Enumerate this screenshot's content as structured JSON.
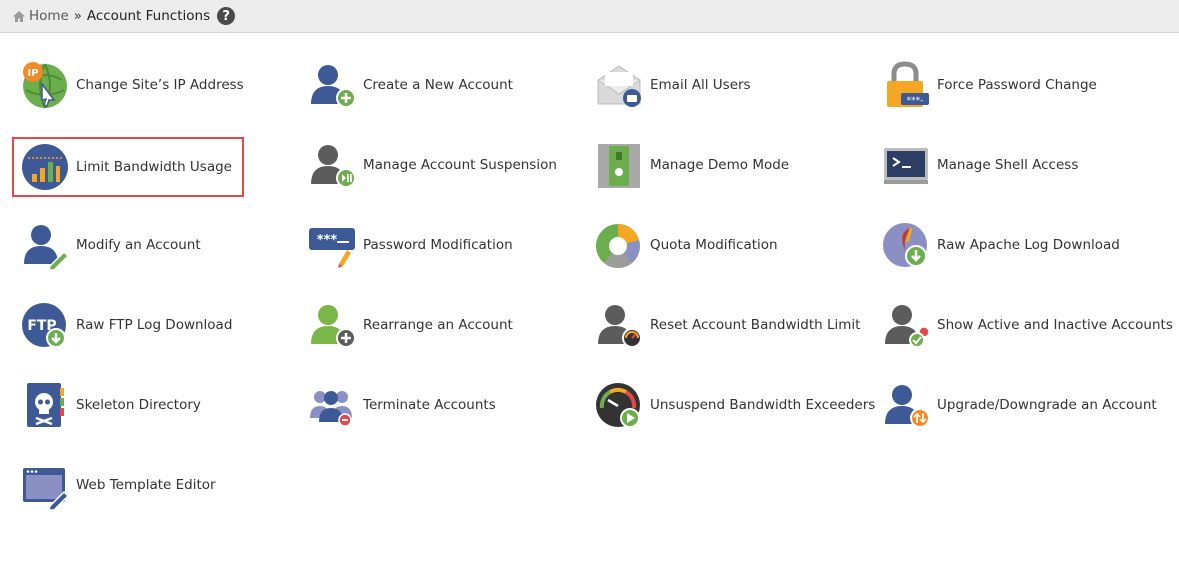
{
  "breadcrumb": {
    "home": "Home",
    "separator": "»",
    "current": "Account Functions",
    "help": "?"
  },
  "items": [
    {
      "label": "Change Site’s IP Address",
      "icon": "ip-address-icon"
    },
    {
      "label": "Create a New Account",
      "icon": "create-account-icon"
    },
    {
      "label": "Email All Users",
      "icon": "email-icon"
    },
    {
      "label": "Force Password Change",
      "icon": "padlock-icon"
    },
    {
      "label": "Limit Bandwidth Usage",
      "icon": "bandwidth-chart-icon",
      "selected": true
    },
    {
      "label": "Manage Account Suspension",
      "icon": "account-suspension-icon"
    },
    {
      "label": "Manage Demo Mode",
      "icon": "demo-mode-icon"
    },
    {
      "label": "Manage Shell Access",
      "icon": "terminal-icon"
    },
    {
      "label": "Modify an Account",
      "icon": "modify-account-icon"
    },
    {
      "label": "Password Modification",
      "icon": "password-icon"
    },
    {
      "label": "Quota Modification",
      "icon": "quota-pie-icon"
    },
    {
      "label": "Raw Apache Log Download",
      "icon": "apache-log-icon"
    },
    {
      "label": "Raw FTP Log Download",
      "icon": "ftp-log-icon"
    },
    {
      "label": "Rearrange an Account",
      "icon": "rearrange-account-icon"
    },
    {
      "label": "Reset Account Bandwidth Limit",
      "icon": "reset-bandwidth-icon"
    },
    {
      "label": "Show Active and Inactive Accounts",
      "icon": "active-accounts-icon"
    },
    {
      "label": "Skeleton Directory",
      "icon": "skeleton-directory-icon"
    },
    {
      "label": "Terminate Accounts",
      "icon": "terminate-accounts-icon"
    },
    {
      "label": "Unsuspend Bandwidth Exceeders",
      "icon": "unsuspend-gauge-icon"
    },
    {
      "label": "Upgrade/Downgrade an Account",
      "icon": "upgrade-downgrade-icon"
    },
    {
      "label": "Web Template Editor",
      "icon": "web-template-icon"
    }
  ],
  "colors": {
    "highlight": "#e8474a",
    "person_blue": "#3d5a96",
    "person_gray": "#5c5c5c",
    "person_green": "#7ab648",
    "accent_orange": "#f5a623"
  }
}
